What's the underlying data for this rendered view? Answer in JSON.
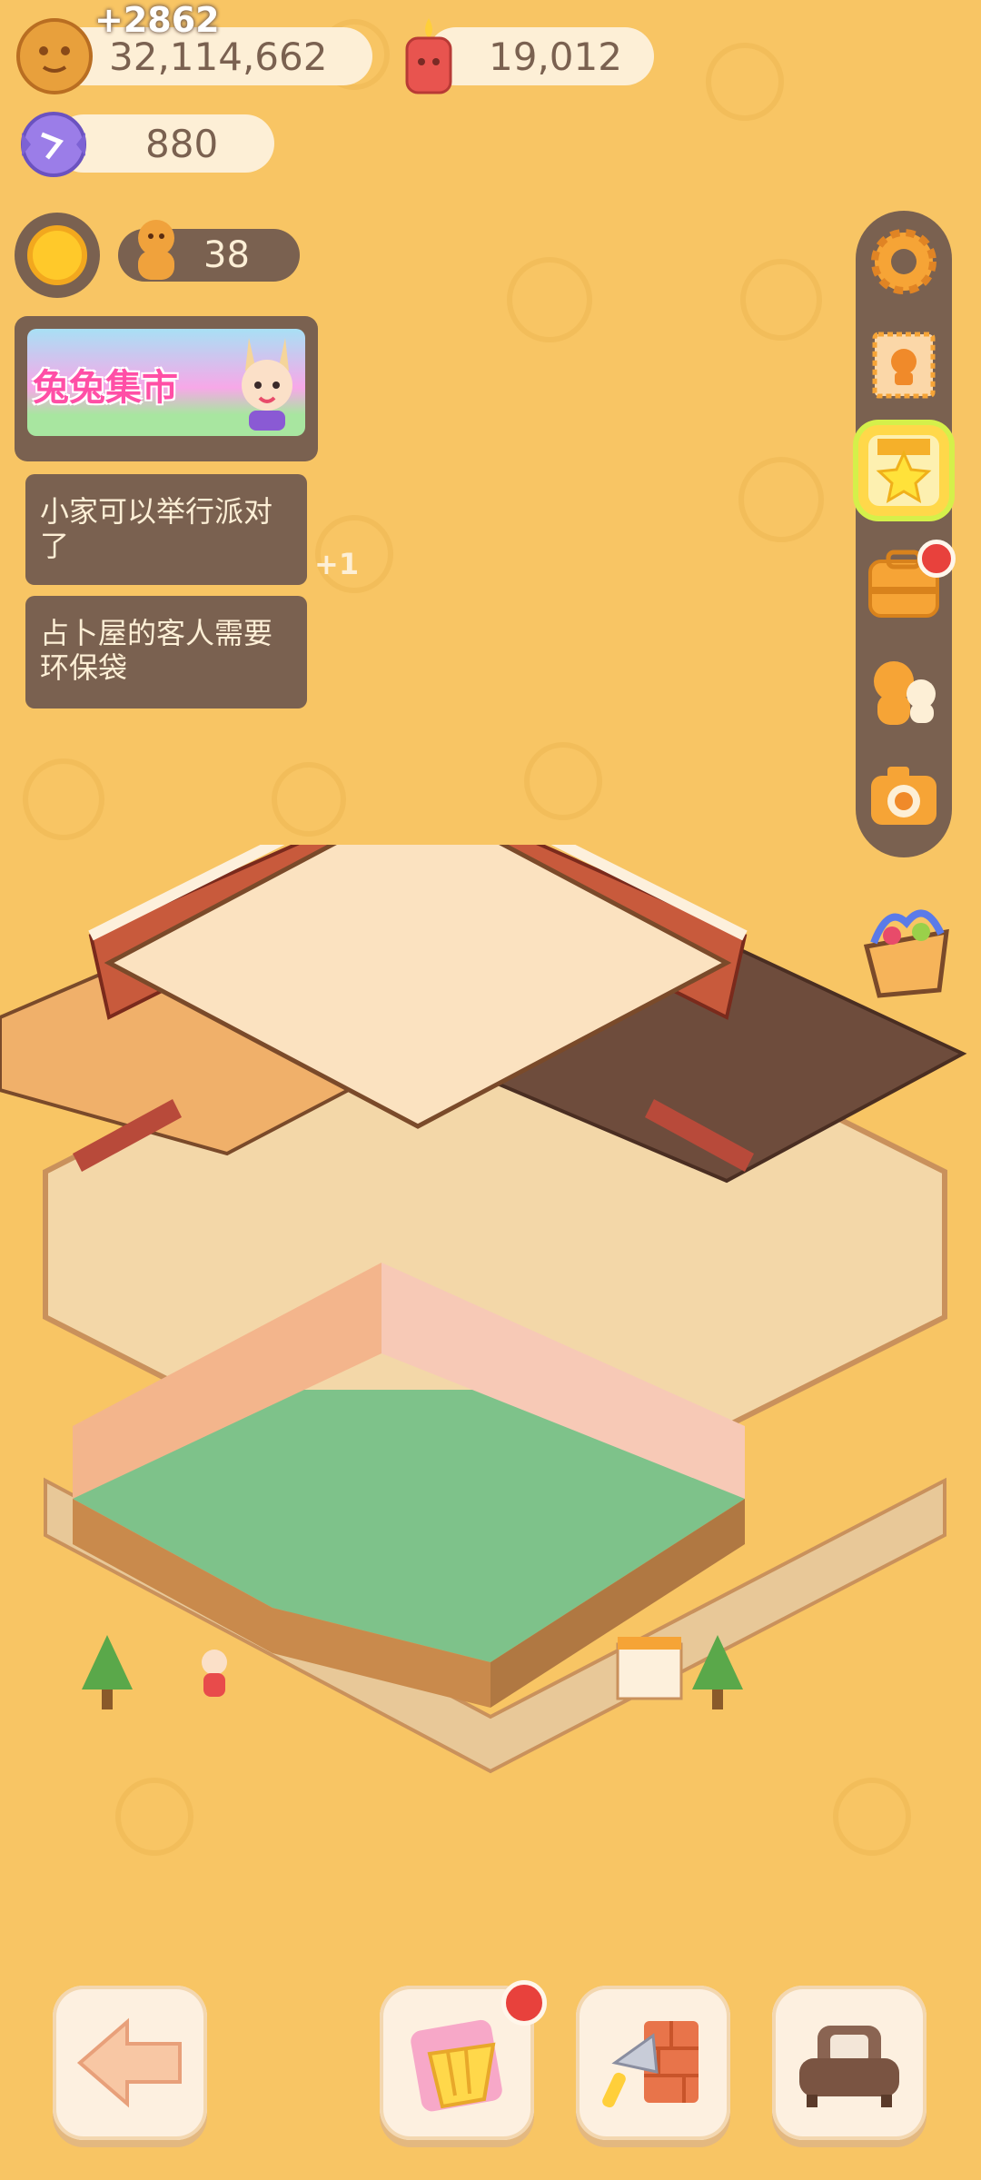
{
  "resources": {
    "cookies": {
      "value": "32,114,662",
      "gain": "+2862",
      "icon": "cookie-icon"
    },
    "candle": {
      "value": "19,012",
      "icon": "candle-icon"
    },
    "gem": {
      "value": "880",
      "icon": "crystal-candy-icon"
    }
  },
  "status": {
    "count": "38",
    "icons": [
      "sun-icon",
      "gingerbread-icon"
    ]
  },
  "event_banner": {
    "label": "兔兔集市"
  },
  "quests": [
    {
      "text": "小家可以举行派对了",
      "badge": "+1"
    },
    {
      "text": "占卜屋的客人需要环保袋"
    }
  ],
  "side_menu": [
    "settings-gear-icon",
    "stamp-card-icon",
    "star-events-icon",
    "backpack-icon",
    "friends-icon",
    "camera-icon"
  ],
  "bottom_bar": [
    "back-arrow-icon",
    "decor-pack-icon",
    "build-trowel-icon",
    "furniture-sofa-icon"
  ],
  "colors": {
    "background": "#f8c564",
    "panel": "#7a6150",
    "pill": "#fdefd6",
    "notification": "#e8413c"
  }
}
